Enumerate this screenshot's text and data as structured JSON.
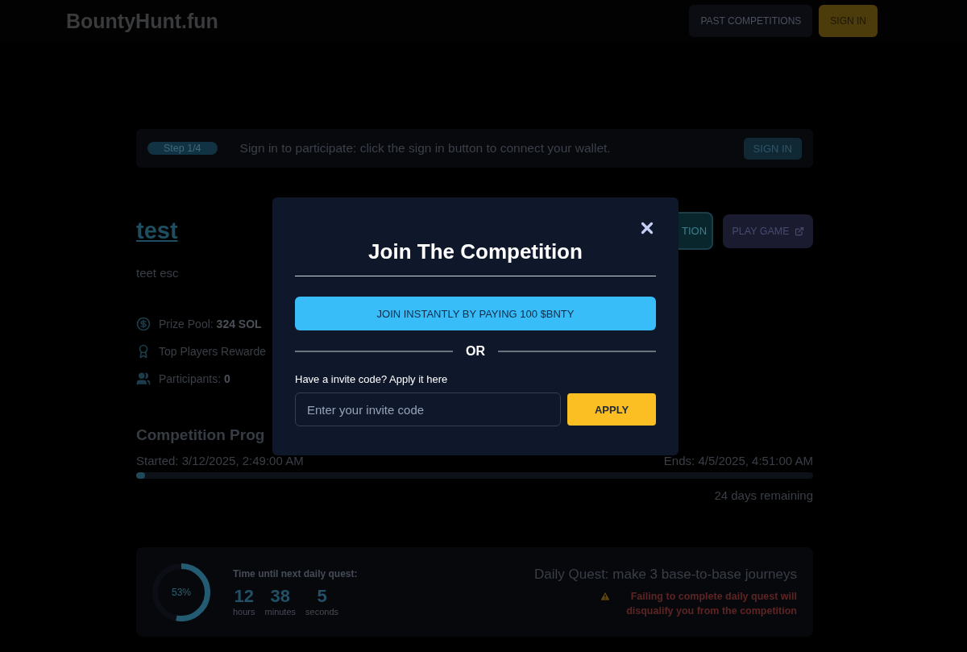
{
  "header": {
    "logo": "BountyHunt.fun",
    "buttons": [
      {
        "label": "PAST COMPETITIONS",
        "kind": "secondary"
      },
      {
        "label": "SIGN IN",
        "kind": "primary"
      }
    ]
  },
  "step_banner": {
    "step": "Step 1/4",
    "message": "Sign in to participate: click the sign in button to connect your wallet.",
    "button": "SIGN IN"
  },
  "competition": {
    "title": "test",
    "description": "teet esc",
    "actions": [
      {
        "label": "TION",
        "kind": "join"
      },
      {
        "label": "PLAY GAME",
        "kind": "play"
      }
    ],
    "stats": [
      {
        "kind": "prize",
        "text": "Prize Pool: **324 SOL**"
      },
      {
        "kind": "rewards",
        "text": "Top Players Rewarde"
      },
      {
        "kind": "participants",
        "text": "Participants: **0**"
      }
    ]
  },
  "progress": {
    "heading": "Competition Prog",
    "started": "Started: 3/12/2025, 2:49:00 AM",
    "ends": "Ends: 4/5/2025, 4:51:00 AM",
    "level": 0.013,
    "remaining": "24 days remaining"
  },
  "daily_quest": {
    "ring_label": "53%",
    "level": 0.53,
    "countdown_title": "Time until next daily quest:",
    "countdown": [
      {
        "value": "12",
        "unit": "hours"
      },
      {
        "value": "38",
        "unit": "minutes"
      },
      {
        "value": "5",
        "unit": "seconds"
      }
    ],
    "quest": "Daily Quest: make 3 base-to-base journeys",
    "warning": "Failing to complete daily quest will disqualify you from the competition"
  },
  "modal": {
    "title": "Join The Competition",
    "join_button": "JOIN INSTANTLY BY PAYING 100 $BNTY",
    "divider": "OR",
    "invite_label": "Have a invite code? Apply it here",
    "invite_field": {
      "placeholder": "Enter your invite code"
    },
    "apply_button": "APPLY"
  }
}
